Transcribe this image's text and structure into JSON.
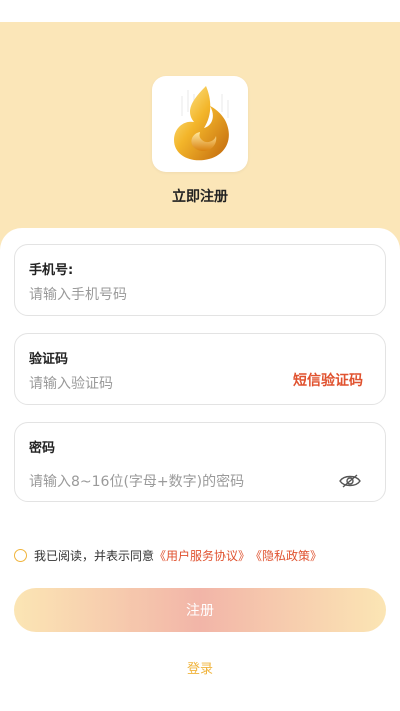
{
  "header": {
    "title": "立即注册"
  },
  "form": {
    "phone": {
      "label": "手机号:",
      "placeholder": "请输入手机号码"
    },
    "code": {
      "label": "验证码",
      "placeholder": "请输入验证码",
      "sms_button": "短信验证码"
    },
    "password": {
      "label": "密码",
      "placeholder": "请输入8~16位(字母+数字)的密码",
      "toggle_icon": "eye-off-icon"
    }
  },
  "agreement": {
    "checked": false,
    "prefix": "我已阅读，并表示同意",
    "user_agreement": "《用户服务协议》",
    "privacy_policy": "《隐私政策》"
  },
  "actions": {
    "register": "注册",
    "login": "登录"
  },
  "colors": {
    "header_bg": "#fbe6b8",
    "accent_red": "#e0522f",
    "accent_gold": "#f0b43c"
  }
}
